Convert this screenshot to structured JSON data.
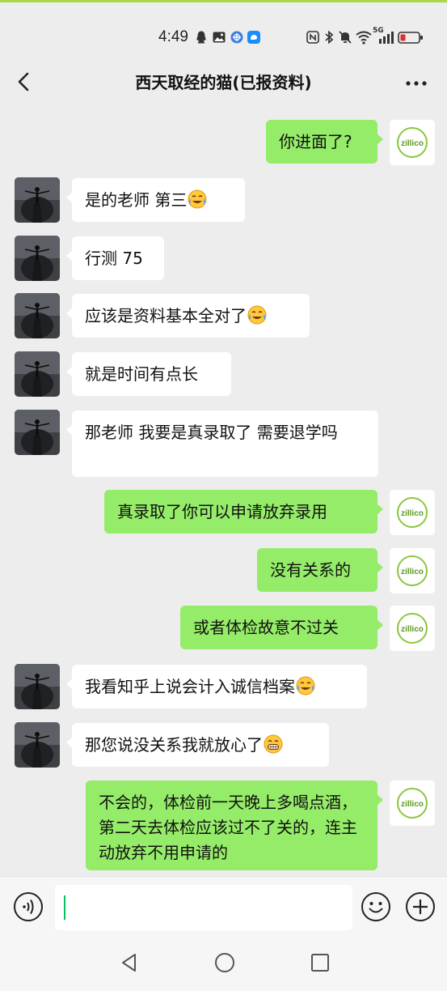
{
  "status_bar": {
    "time": "4:49",
    "network": "5G",
    "icons": [
      "qq-penguin-icon",
      "image-icon",
      "browser-icon",
      "app-icon",
      "nfc-icon",
      "bluetooth-icon",
      "mute-icon",
      "wifi-icon",
      "signal-icon",
      "battery-icon"
    ]
  },
  "header": {
    "title": "西天取经的猫(已报资料)",
    "back_icon": "chevron-left-icon",
    "more_icon": "more-dots-icon"
  },
  "colors": {
    "background": "#ededed",
    "outgoing_bubble": "#95ec69",
    "incoming_bubble": "#ffffff",
    "accent": "#07c160"
  },
  "messages": [
    {
      "side": "out",
      "text": "你进面了?",
      "emoji": ""
    },
    {
      "side": "in",
      "text": "是的老师  第三",
      "emoji": "cry-laugh-emoji"
    },
    {
      "side": "in",
      "text": "行测 75",
      "emoji": ""
    },
    {
      "side": "in",
      "text": "应该是资料基本全对了",
      "emoji": "cry-laugh-emoji"
    },
    {
      "side": "in",
      "text": "就是时间有点长",
      "emoji": ""
    },
    {
      "side": "in",
      "text": "那老师   我要是真录取了  需要退学吗",
      "emoji": ""
    },
    {
      "side": "out",
      "text": "真录取了你可以申请放弃录用",
      "emoji": ""
    },
    {
      "side": "out",
      "text": "没有关系的",
      "emoji": ""
    },
    {
      "side": "out",
      "text": "或者体检故意不过关",
      "emoji": ""
    },
    {
      "side": "in",
      "text": "我看知乎上说会计入诚信档案",
      "emoji": "cry-laugh-emoji"
    },
    {
      "side": "in",
      "text": "那您说没关系我就放心了",
      "emoji": "grin-emoji"
    },
    {
      "side": "out",
      "text": "不会的，体检前一天晚上多喝点酒，第二天去体检应该过不了关的，连主动放弃不用申请的",
      "emoji": ""
    }
  ],
  "avatars": {
    "me_logo_text": "zillico",
    "contact": "person-on-rock-avatar"
  },
  "input_bar": {
    "value": "",
    "voice_icon": "voice-icon",
    "emoji_icon": "emoji-icon",
    "plus_icon": "plus-circle-icon"
  },
  "nav_bar": {
    "icons": [
      "nav-back-icon",
      "nav-home-icon",
      "nav-recents-icon"
    ]
  }
}
